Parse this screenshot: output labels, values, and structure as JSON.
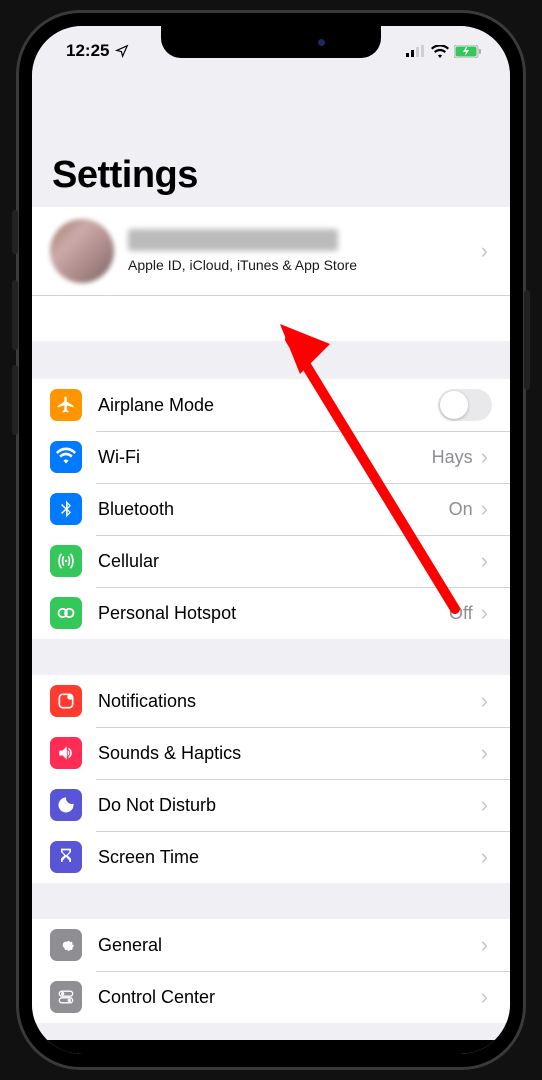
{
  "status": {
    "time": "12:25",
    "location_arrow": "↗"
  },
  "page_title": "Settings",
  "profile": {
    "subtitle": "Apple ID, iCloud, iTunes & App Store"
  },
  "group1": {
    "airplane": {
      "label": "Airplane Mode"
    },
    "wifi": {
      "label": "Wi-Fi",
      "detail": "Hays"
    },
    "bluetooth": {
      "label": "Bluetooth",
      "detail": "On"
    },
    "cellular": {
      "label": "Cellular"
    },
    "hotspot": {
      "label": "Personal Hotspot",
      "detail": "Off"
    }
  },
  "group2": {
    "notifications": {
      "label": "Notifications"
    },
    "sounds": {
      "label": "Sounds & Haptics"
    },
    "dnd": {
      "label": "Do Not Disturb"
    },
    "screentime": {
      "label": "Screen Time"
    }
  },
  "group3": {
    "general": {
      "label": "General"
    },
    "controlcenter": {
      "label": "Control Center"
    }
  },
  "colors": {
    "orange": "#ff9500",
    "blue": "#007aff",
    "green": "#34c759",
    "red": "#ff3b30",
    "pink": "#ff2d55",
    "purple": "#5856d6",
    "gray": "#8e8e93"
  }
}
